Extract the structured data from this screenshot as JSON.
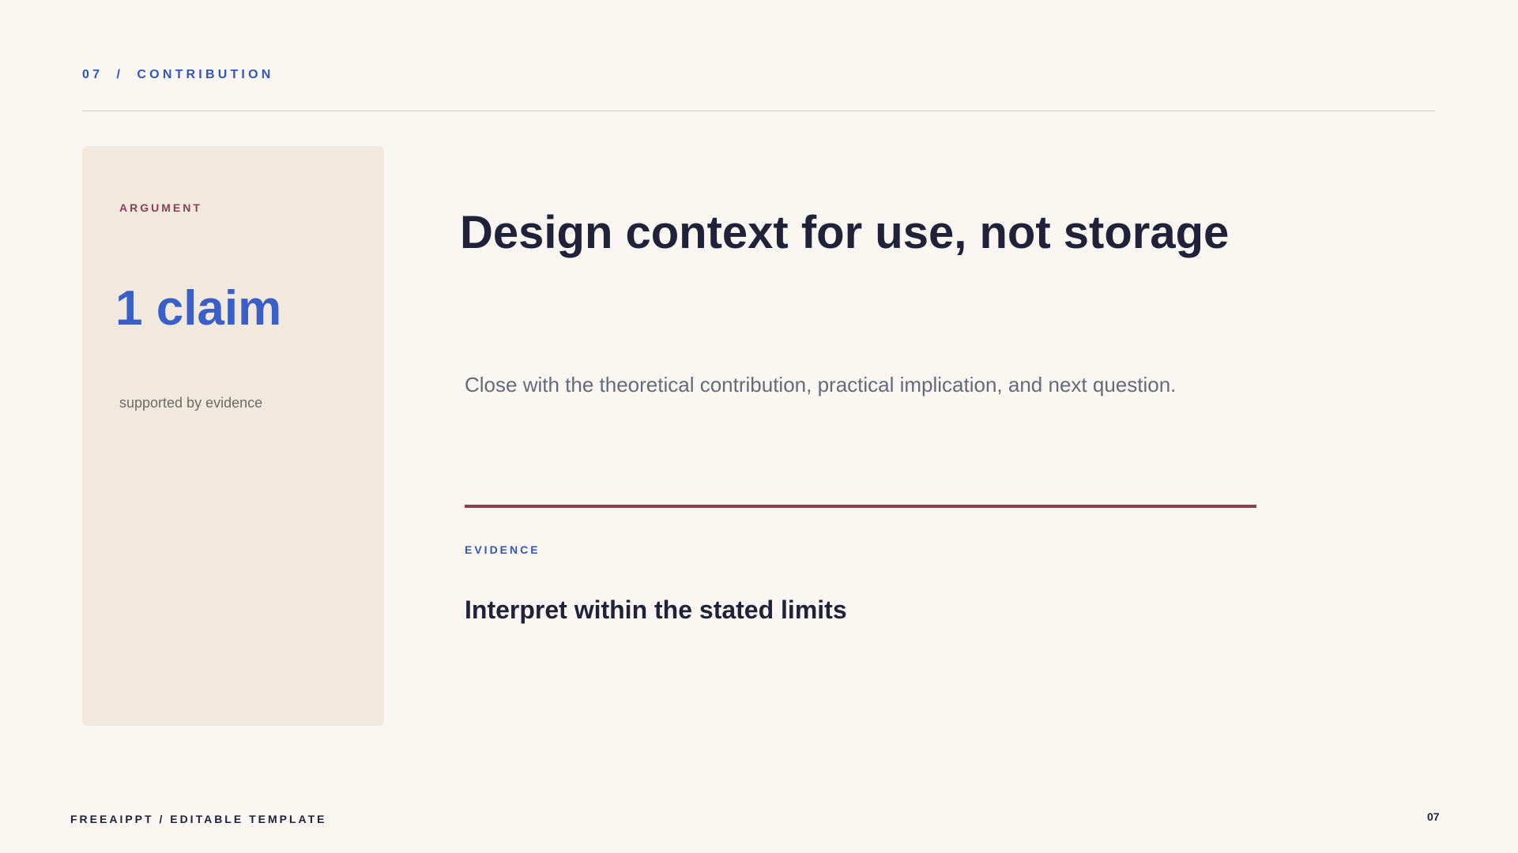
{
  "header": {
    "section_label": "07  /  CONTRIBUTION"
  },
  "sidebar_card": {
    "label": "ARGUMENT",
    "metric": "1 claim",
    "caption": "supported by evidence"
  },
  "main": {
    "headline": "Design context for use, not storage",
    "subtitle": "Close with the theoretical contribution, practical implication, and next question.",
    "evidence_label": "EVIDENCE",
    "evidence_text": "Interpret within the stated limits"
  },
  "footer": {
    "brand": "FREEAIPPT / EDITABLE TEMPLATE",
    "page_number": "07"
  },
  "colors": {
    "background": "#faf7f2",
    "card_background": "#f2e9de",
    "accent_blue": "#3a5fc9",
    "accent_maroon": "#8a3f55",
    "text_dark": "#20223a",
    "text_muted": "#666a78"
  }
}
